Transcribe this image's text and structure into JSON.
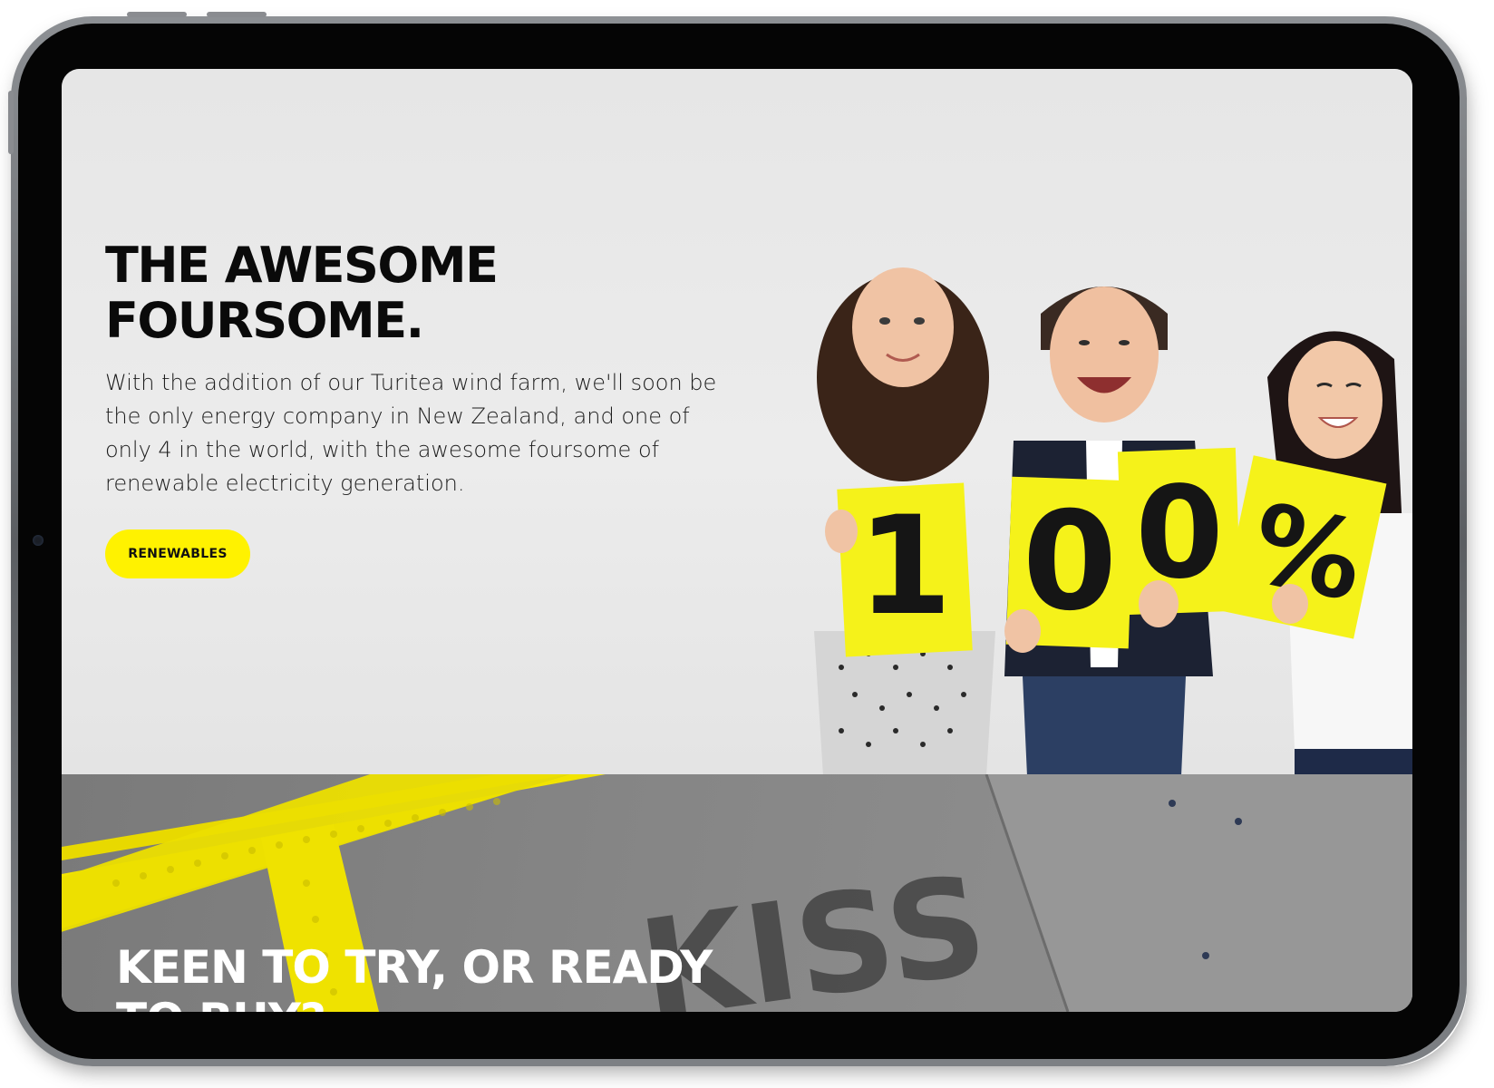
{
  "hero": {
    "title_line1": "THE AWESOME",
    "title_line2": "FOURSOME.",
    "body": "With the addition of our Turitea wind farm, we'll soon be the only energy company in New Zealand, and one of only 4 in the world, with the awesome foursome of renewable electricity generation.",
    "cta_label": "RENEWABLES",
    "sign_chars": [
      "1",
      "0",
      "0",
      "%"
    ]
  },
  "lower": {
    "title": "KEEN TO TRY, OR READY TO BUY?",
    "pavement_text": "KISS"
  },
  "colors": {
    "accent": "#fff200",
    "hero_background": "#e8e8e8",
    "pavement": "#858585",
    "text_dark": "#0a0a0a"
  }
}
